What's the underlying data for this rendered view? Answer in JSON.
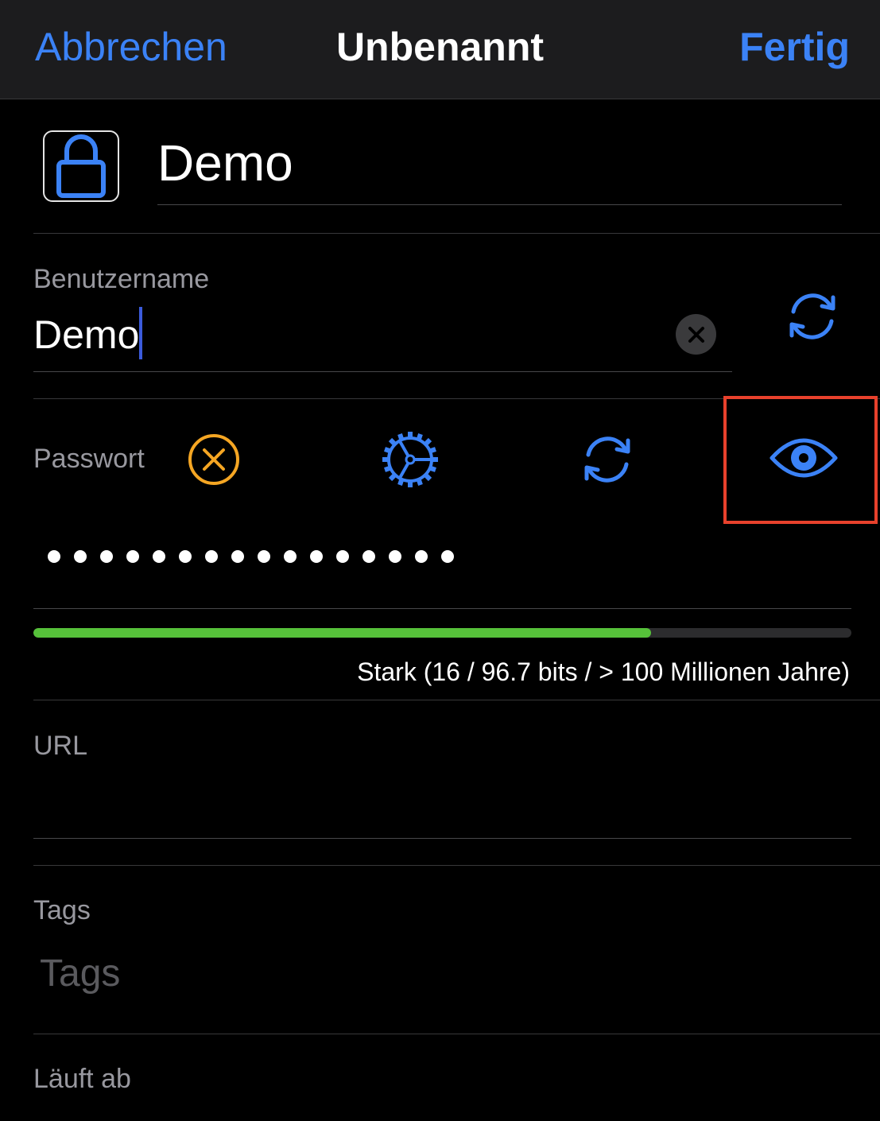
{
  "nav": {
    "cancel_label": "Abbrechen",
    "title": "Unbenannt",
    "done_label": "Fertig"
  },
  "entry": {
    "icon": "lock-icon",
    "title_value": "Demo"
  },
  "username": {
    "label": "Benutzername",
    "value": "Demo"
  },
  "password": {
    "label": "Passwort",
    "masked_value": "••••••••••••••••",
    "length": 16,
    "actions": [
      "clear-password-icon",
      "password-generator-settings-icon",
      "regenerate-password-icon",
      "show-password-icon"
    ],
    "strength_fraction": 0.755,
    "strength_text": "Stark (16 / 96.7 bits / > 100 Millionen Jahre)"
  },
  "url": {
    "label": "URL",
    "value": ""
  },
  "tags": {
    "label": "Tags",
    "placeholder": "Tags"
  },
  "expires": {
    "label": "Läuft ab"
  },
  "colors": {
    "accent": "#3b82f6",
    "warning": "#f5a623",
    "strength": "#56c13a",
    "highlight": "#e8412c"
  }
}
